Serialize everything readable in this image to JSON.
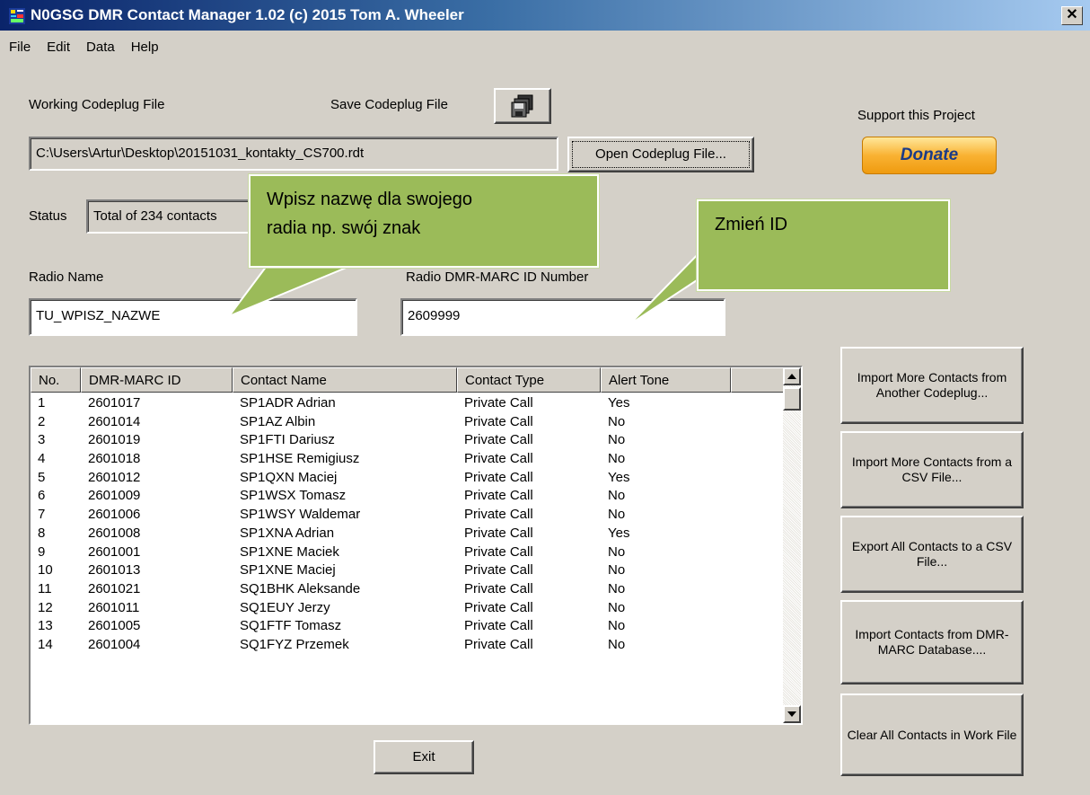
{
  "window": {
    "title": "N0GSG DMR Contact Manager 1.02 (c) 2015 Tom A. Wheeler",
    "close_symbol": "✕"
  },
  "menu": [
    "File",
    "Edit",
    "Data",
    "Help"
  ],
  "codeplug": {
    "working_label": "Working Codeplug File",
    "save_label": "Save Codeplug File",
    "file_path": "C:\\Users\\Artur\\Desktop\\20151031_kontakty_CS700.rdt",
    "open_button": "Open Codeplug File..."
  },
  "support": {
    "label": "Support this Project",
    "donate_button": "Donate"
  },
  "status": {
    "label": "Status",
    "value": "Total of 234 contacts"
  },
  "radio": {
    "name_label": "Radio Name",
    "name_value": "TU_WPISZ_NAZWE",
    "id_label": "Radio DMR-MARC ID Number",
    "id_value": "2609999"
  },
  "callouts": {
    "name_hint_line1": "Wpisz nazwę dla swojego",
    "name_hint_line2": "radia np. swój znak",
    "id_hint": "Zmień ID"
  },
  "contacts": {
    "columns": [
      "No.",
      "DMR-MARC ID",
      "Contact Name",
      "Contact Type",
      "Alert Tone"
    ],
    "rows": [
      [
        "1",
        "2601017",
        "SP1ADR Adrian",
        "Private Call",
        "Yes"
      ],
      [
        "2",
        "2601014",
        "SP1AZ Albin",
        "Private Call",
        "No"
      ],
      [
        "3",
        "2601019",
        "SP1FTI Dariusz",
        "Private Call",
        "No"
      ],
      [
        "4",
        "2601018",
        "SP1HSE Remigiusz",
        "Private Call",
        "No"
      ],
      [
        "5",
        "2601012",
        "SP1QXN Maciej",
        "Private Call",
        "Yes"
      ],
      [
        "6",
        "2601009",
        "SP1WSX Tomasz",
        "Private Call",
        "No"
      ],
      [
        "7",
        "2601006",
        "SP1WSY Waldemar",
        "Private Call",
        "No"
      ],
      [
        "8",
        "2601008",
        "SP1XNA Adrian",
        "Private Call",
        "Yes"
      ],
      [
        "9",
        "2601001",
        "SP1XNE Maciek",
        "Private Call",
        "No"
      ],
      [
        "10",
        "2601013",
        "SP1XNE Maciej",
        "Private Call",
        "No"
      ],
      [
        "11",
        "2601021",
        "SQ1BHK Aleksande",
        "Private Call",
        "No"
      ],
      [
        "12",
        "2601011",
        "SQ1EUY Jerzy",
        "Private Call",
        "No"
      ],
      [
        "13",
        "2601005",
        "SQ1FTF Tomasz",
        "Private Call",
        "No"
      ],
      [
        "14",
        "2601004",
        "SQ1FYZ Przemek",
        "Private Call",
        "No"
      ]
    ]
  },
  "actions": {
    "import_codeplug": "Import More Contacts from Another Codeplug...",
    "import_csv": "Import More Contacts from a CSV File...",
    "export_csv": "Export All Contacts to a CSV File...",
    "import_dmr_marc": "Import Contacts from DMR-MARC Database....",
    "clear_all": "Clear All Contacts in Work File"
  },
  "exit_button": "Exit",
  "colors": {
    "window_bg": "#d4d0c8",
    "titlebar_start": "#0a246a",
    "titlebar_end": "#a6caf0",
    "callout_green": "#9bbb59",
    "donate_orange": "#f9b233",
    "donate_text": "#1b3b87"
  },
  "icons": {
    "save": "floppy-disks-icon",
    "app": "app-icon"
  }
}
